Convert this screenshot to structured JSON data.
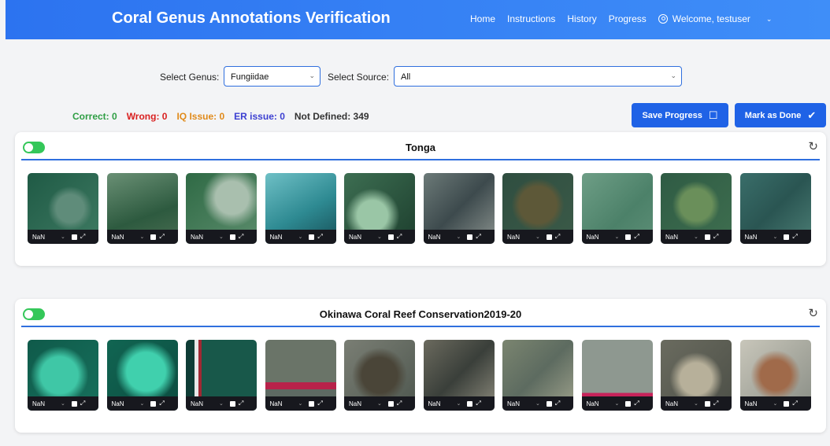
{
  "header": {
    "title": "Coral Genus Annotations Verification",
    "nav": [
      "Home",
      "Instructions",
      "History",
      "Progress"
    ],
    "welcome": "Welcome, testuser",
    "accent": "#2c73f0"
  },
  "filters": {
    "genus_label": "Select Genus:",
    "genus_value": "Fungiidae",
    "source_label": "Select Source:",
    "source_value": "All"
  },
  "stats": {
    "correct": "Correct: 0",
    "wrong": "Wrong: 0",
    "iq": "IQ Issue: 0",
    "er": "ER issue: 0",
    "undefined": "Not Defined: 349",
    "colors": {
      "correct": "#2e9e44",
      "wrong": "#d92020",
      "iq": "#e08a1a",
      "er": "#3b3fd1",
      "undefined": "#333333"
    }
  },
  "buttons": {
    "save": "Save Progress",
    "done": "Mark as Done"
  },
  "cards": [
    {
      "title": "Tonga",
      "thumb_value": "NaN",
      "count": 10
    },
    {
      "title": "Okinawa Coral Reef Conservation2019-20",
      "thumb_value": "NaN",
      "count": 10
    }
  ]
}
